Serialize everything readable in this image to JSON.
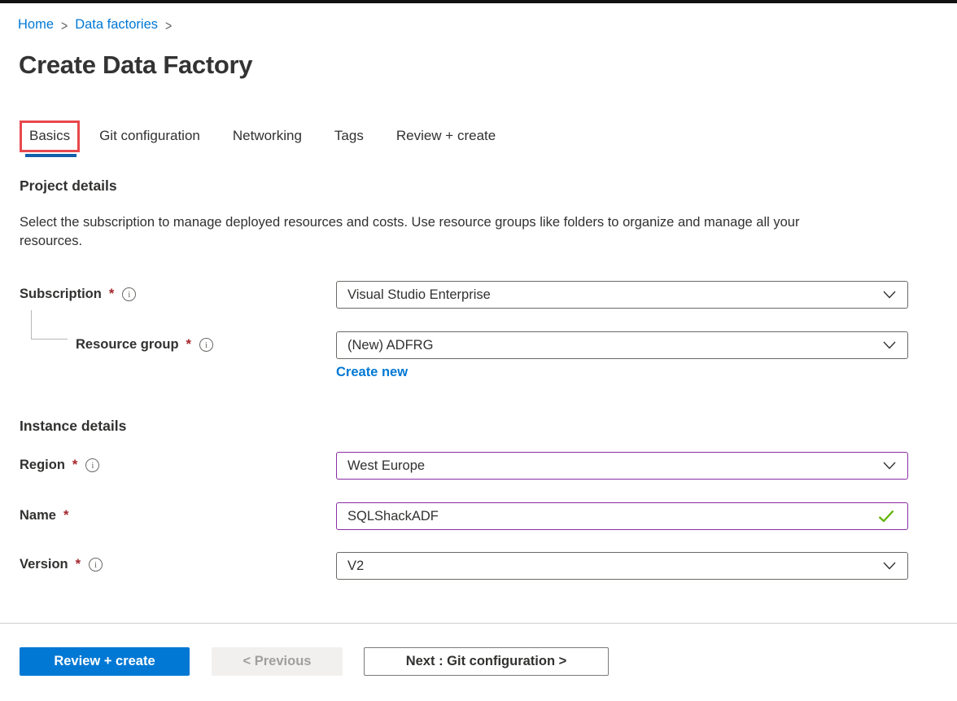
{
  "breadcrumb": {
    "items": [
      {
        "label": "Home"
      },
      {
        "label": "Data factories"
      }
    ],
    "separator": ">"
  },
  "header": {
    "title": "Create Data Factory"
  },
  "tabs": [
    {
      "label": "Basics",
      "active": true,
      "annotated": true
    },
    {
      "label": "Git configuration",
      "active": false
    },
    {
      "label": "Networking",
      "active": false
    },
    {
      "label": "Tags",
      "active": false
    },
    {
      "label": "Review + create",
      "active": false
    }
  ],
  "project_details": {
    "heading": "Project details",
    "description": "Select the subscription to manage deployed resources and costs. Use resource groups like folders to organize and manage all your resources."
  },
  "instance_details": {
    "heading": "Instance details"
  },
  "fields": {
    "subscription": {
      "label": "Subscription",
      "required_marker": "*",
      "value": "Visual Studio Enterprise",
      "control": "dropdown",
      "has_info_icon": true
    },
    "resource_group": {
      "label": "Resource group",
      "required_marker": "*",
      "value": "(New) ADFRG",
      "control": "dropdown",
      "has_info_icon": true,
      "create_new_label": "Create new"
    },
    "region": {
      "label": "Region",
      "required_marker": "*",
      "value": "West Europe",
      "control": "dropdown",
      "has_info_icon": true,
      "state": "edited"
    },
    "name": {
      "label": "Name",
      "required_marker": "*",
      "value": "SQLShackADF",
      "control": "text-input",
      "has_info_icon": false,
      "state": "edited-valid"
    },
    "version": {
      "label": "Version",
      "required_marker": "*",
      "value": "V2",
      "control": "dropdown",
      "has_info_icon": true
    }
  },
  "footer": {
    "review_create_label": "Review + create",
    "previous_label": "< Previous",
    "next_label": "Next : Git configuration >"
  },
  "icons": {
    "info": "i",
    "breadcrumb_separator": ">",
    "chevron_down": "⌄",
    "checkmark": "✓"
  },
  "colors": {
    "accent_blue": "#0078d4",
    "active_tab_underline": "#1160aa",
    "annotation_red": "#e8484d",
    "required_red": "#a4262c",
    "edited_field_purple": "#8a2da5",
    "valid_green": "#5db300",
    "text_primary": "#323130",
    "disabled_text": "#a19f9d"
  }
}
